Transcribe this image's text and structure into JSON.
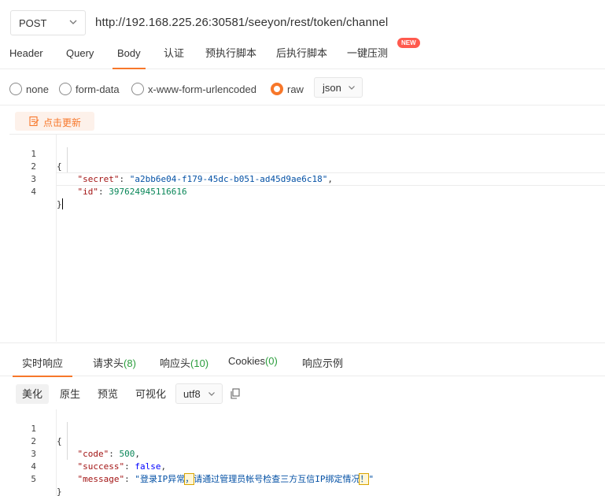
{
  "request": {
    "method": "POST",
    "url": "http://192.168.225.26:30581/seeyon/rest/token/channel"
  },
  "req_tabs": [
    {
      "label": "Header"
    },
    {
      "label": "Query"
    },
    {
      "label": "Body"
    },
    {
      "label": "认证"
    },
    {
      "label": "预执行脚本"
    },
    {
      "label": "后执行脚本"
    },
    {
      "label": "一键压测"
    }
  ],
  "new_badge": "NEW",
  "body_types": [
    {
      "label": "none"
    },
    {
      "label": "form-data"
    },
    {
      "label": "x-www-form-urlencoded"
    },
    {
      "label": "raw"
    }
  ],
  "raw_format": "json",
  "update_button": "点击更新",
  "request_body": {
    "line_numbers": [
      "1",
      "2",
      "3",
      "4"
    ],
    "open_brace": "{",
    "close_brace": "}",
    "secret_key": "\"secret\"",
    "secret_value": "\"a2bb6e04-f179-45dc-b051-ad45d9ae6c18\"",
    "id_key": "\"id\"",
    "id_value": "397624945116616"
  },
  "resp_tabs": [
    {
      "label": "实时响应",
      "count": ""
    },
    {
      "label": "请求头",
      "count": "(8)"
    },
    {
      "label": "响应头",
      "count": "(10)"
    },
    {
      "label": "Cookies",
      "count": "(0)"
    },
    {
      "label": "响应示例",
      "count": ""
    }
  ],
  "view_modes": [
    {
      "label": "美化"
    },
    {
      "label": "原生"
    },
    {
      "label": "预览"
    },
    {
      "label": "可视化"
    }
  ],
  "encoding": "utf8",
  "response_body": {
    "line_numbers": [
      "1",
      "2",
      "3",
      "4",
      "5"
    ],
    "open_brace": "{",
    "close_brace": "}",
    "code_key": "\"code\"",
    "code_value": "500",
    "success_key": "\"success\"",
    "success_value": "false",
    "message_key": "\"message\"",
    "message_part1": "\"登录IP异常",
    "message_punct1": "，",
    "message_part2": "请通过管理员帐号检查三方互信IP绑定情况",
    "message_punct2": "！",
    "message_end": "\""
  },
  "colors": {
    "accent": "#f7772a",
    "count_green": "#2a9d3c",
    "badge_red": "#ff5a4e"
  }
}
